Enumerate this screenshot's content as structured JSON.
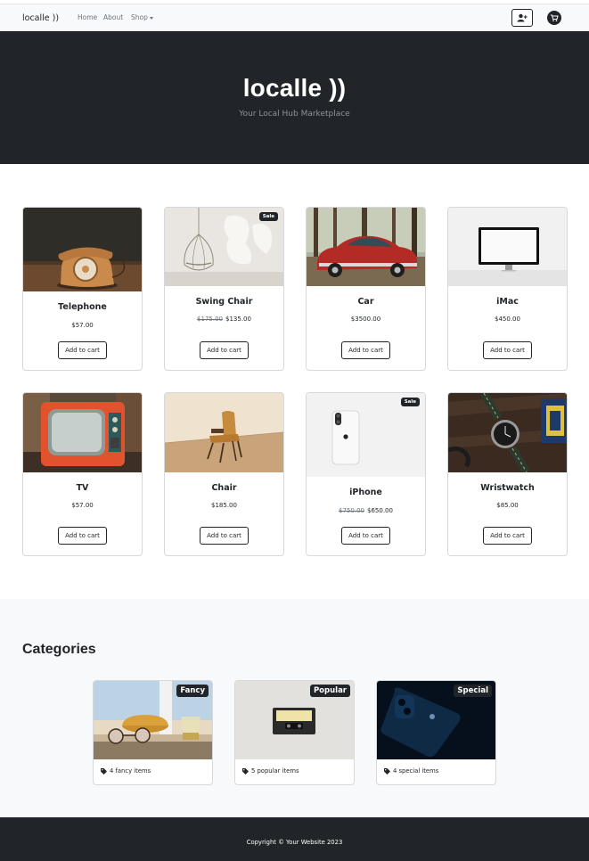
{
  "navbar": {
    "brand": "localle ))",
    "links": [
      {
        "label": "Home"
      },
      {
        "label": "About"
      },
      {
        "label": "Shop"
      }
    ],
    "icons": [
      "user-plus-icon",
      "cart-icon"
    ]
  },
  "header": {
    "title": "localle ))",
    "subtitle": "Your Local Hub Marketplace"
  },
  "products": [
    {
      "name": "Telephone",
      "price": "$57.00",
      "old_price": "",
      "button": "Add to cart",
      "sale": false
    },
    {
      "name": "Swing Chair",
      "price": "$135.00",
      "old_price": "$175.00",
      "button": "Add to cart",
      "sale": true,
      "badge": "Sale"
    },
    {
      "name": "Car",
      "price": "$3500.00",
      "old_price": "",
      "button": "Add to cart",
      "sale": false
    },
    {
      "name": "iMac",
      "price": "$450.00",
      "old_price": "",
      "button": "Add to cart",
      "sale": false
    },
    {
      "name": "TV",
      "price": "$57.00",
      "old_price": "",
      "button": "Add to cart",
      "sale": false
    },
    {
      "name": "Chair",
      "price": "$185.00",
      "old_price": "",
      "button": "Add to cart",
      "sale": false
    },
    {
      "name": "iPhone",
      "price": "$650.00",
      "old_price": "$750.00",
      "button": "Add to cart",
      "sale": true,
      "badge": "Sale"
    },
    {
      "name": "Wristwatch",
      "price": "$85.00",
      "old_price": "",
      "button": "Add to cart",
      "sale": false
    }
  ],
  "categories": {
    "heading": "Categories",
    "items": [
      {
        "badge": "Fancy",
        "text": "4 fancy items"
      },
      {
        "badge": "Popular",
        "text": "5 popular items"
      },
      {
        "badge": "Special",
        "text": "4 special items"
      }
    ]
  },
  "footer": {
    "text": "Copyright © Your Website 2023"
  },
  "colors": {
    "dark": "#212529",
    "light": "#f8f9fa",
    "muted": "#6c757d"
  }
}
